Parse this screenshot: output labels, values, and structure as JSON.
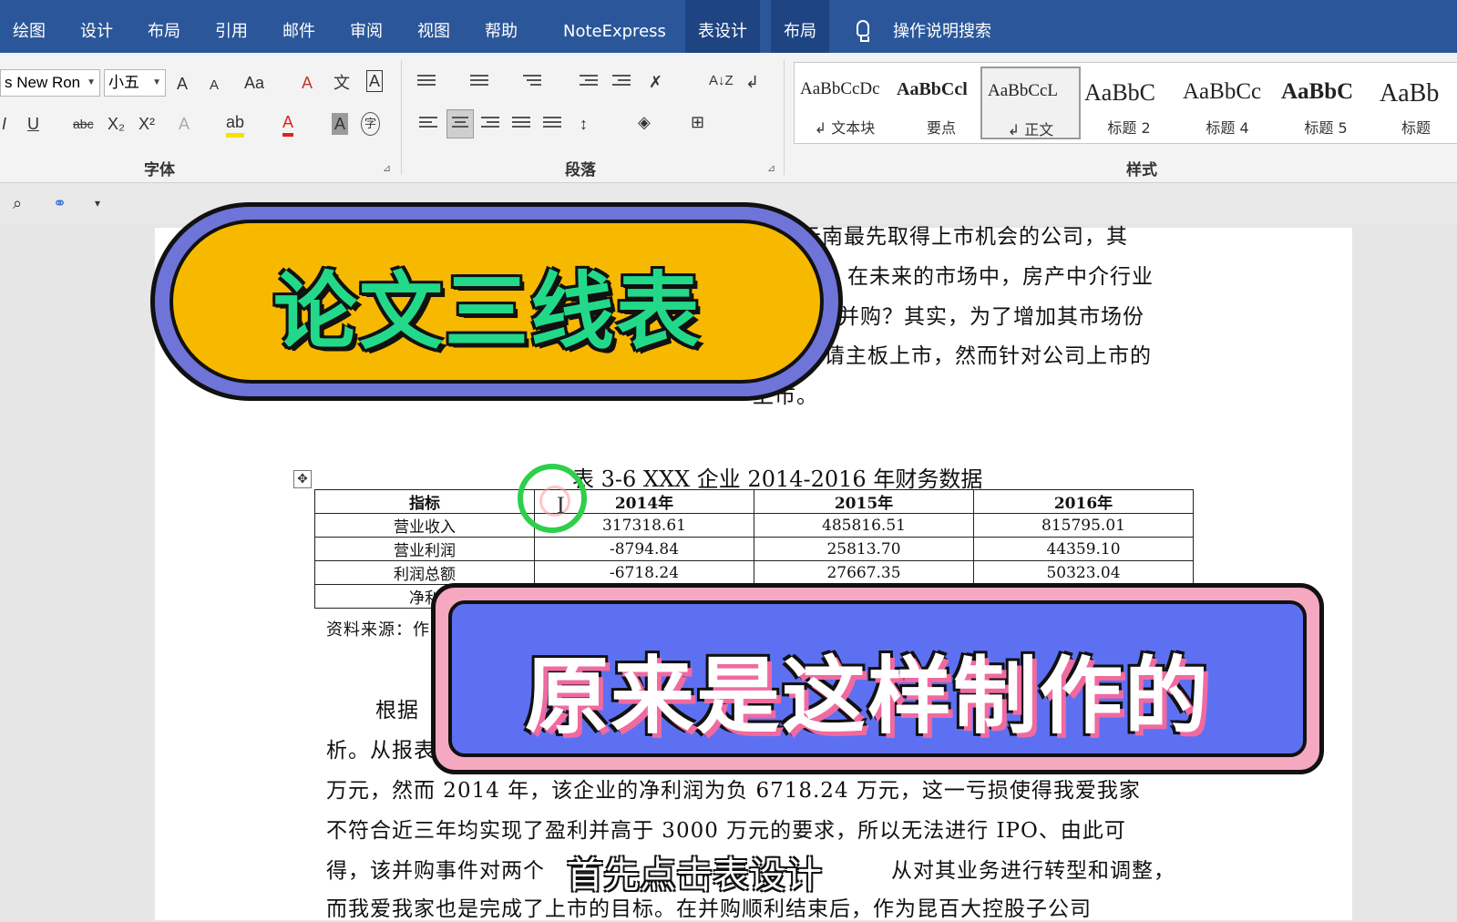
{
  "tabs": [
    {
      "label": "绘图",
      "contextual": false
    },
    {
      "label": "设计",
      "contextual": false
    },
    {
      "label": "布局",
      "contextual": false
    },
    {
      "label": "引用",
      "contextual": false
    },
    {
      "label": "邮件",
      "contextual": false
    },
    {
      "label": "审阅",
      "contextual": false
    },
    {
      "label": "视图",
      "contextual": false
    },
    {
      "label": "帮助",
      "contextual": false
    },
    {
      "label": "NoteExpress",
      "contextual": false
    },
    {
      "label": "表设计",
      "contextual": true
    },
    {
      "label": "布局",
      "contextual": true
    }
  ],
  "search_label": "操作说明搜索",
  "font_group": {
    "label": "字体",
    "font_name": "s New Ron",
    "font_size": "小五",
    "grow": "A",
    "shrink": "A",
    "change_case": "Aa",
    "italic": "I",
    "underline": "U",
    "strike": "abc",
    "subscript": "X₂",
    "superscript": "X²",
    "phonetic": "文",
    "char_border": "A",
    "text_effects": "A",
    "font_color": "A",
    "char_shading": "A",
    "enclosed": "字",
    "font_color_hex": "#e02020",
    "highlight_hex": "#f5e100"
  },
  "paragraph_group": {
    "label": "段落",
    "sort": "A↓Z"
  },
  "styles_group": {
    "label": "样式",
    "items": [
      {
        "sample": "AaBbCcDc",
        "name": "↲ 文本块"
      },
      {
        "sample": "AaBbCcl",
        "name": "要点"
      },
      {
        "sample": "AaBbCcL",
        "name": "↲ 正文"
      },
      {
        "sample": "AaBbC",
        "name": "标题 2"
      },
      {
        "sample": "AaBbCc",
        "name": "标题 4"
      },
      {
        "sample": "AaBbC",
        "name": "标题 5"
      },
      {
        "sample": "AaBb",
        "name": "标题"
      }
    ]
  },
  "document": {
    "lines_top": [
      "云南最先取得上市机会的公司，其",
      "在未来的市场中，房产中介行业",
      "并购？其实，为了增加其市场份",
      "请主板上市，然而针对公司上市的",
      "上市。"
    ],
    "table_caption": "表 3-6 XXX 企业 2014-2016 年财务数据",
    "table": {
      "headers": [
        "指标",
        "2014年",
        "2015年",
        "2016年"
      ],
      "rows": [
        [
          "营业收入",
          "317318.61",
          "485816.51",
          "815795.01"
        ],
        [
          "营业利润",
          "-8794.84",
          "25813.70",
          "44359.10"
        ],
        [
          "利润总额",
          "-6718.24",
          "27667.35",
          "50323.04"
        ],
        [
          "净利",
          "",
          "",
          ""
        ]
      ]
    },
    "source_note": "资料来源：作",
    "lines_bottom": [
      "根据",
      "析。从报表",
      "万元，然而 2014 年，该企业的净利润为负 6718.24 万元，这一亏损使得我爱我家",
      "不符合近三年均实现了盈利并高于 3000 万元的要求，所以无法进行 IPO、由此可",
      "得，该并购事件对两个",
      "从对其业务进行转型和调整，",
      "而我爱我家也是完成了上市的目标。在并购顺利结束后，作为昆百大控股子公司"
    ]
  },
  "overlay": {
    "title": "论文三线表",
    "subtitle": "原来是这样制作的",
    "caption": "首先点击表设计"
  }
}
